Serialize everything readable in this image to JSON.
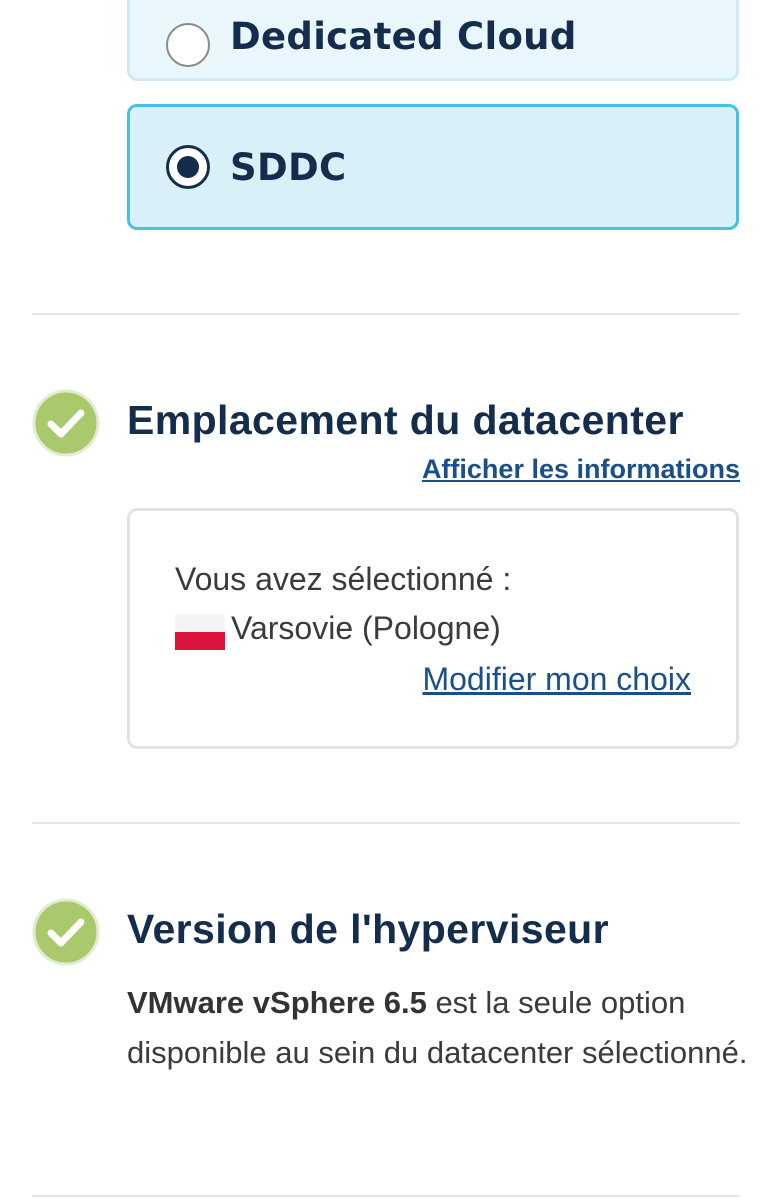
{
  "datacenter_type": {
    "options": [
      {
        "label": "Dedicated Cloud",
        "selected": false
      },
      {
        "label": "SDDC",
        "selected": true
      }
    ]
  },
  "location_section": {
    "title": "Emplacement du datacenter",
    "info_link": "Afficher les informations",
    "selected_label": "Vous avez sélectionné :",
    "selected_city": "Varsovie (Pologne)",
    "flag_icon": "poland-flag-icon",
    "modify_link": "Modifier mon choix",
    "status_icon": "check-circle-icon"
  },
  "hypervisor_section": {
    "title": "Version de l'hyperviseur",
    "version_name": "VMware vSphere 6.5",
    "description": " est la seule option disponible au sein du datacenter sélectionné.",
    "status_icon": "check-circle-icon"
  },
  "colors": {
    "accent_border": "#48c0e3",
    "option_bg": "#e9f6fb",
    "selected_bg": "#d9f0f8",
    "check_green": "#a9c96c",
    "heading": "#142d4c",
    "link": "#1b4f8a"
  }
}
